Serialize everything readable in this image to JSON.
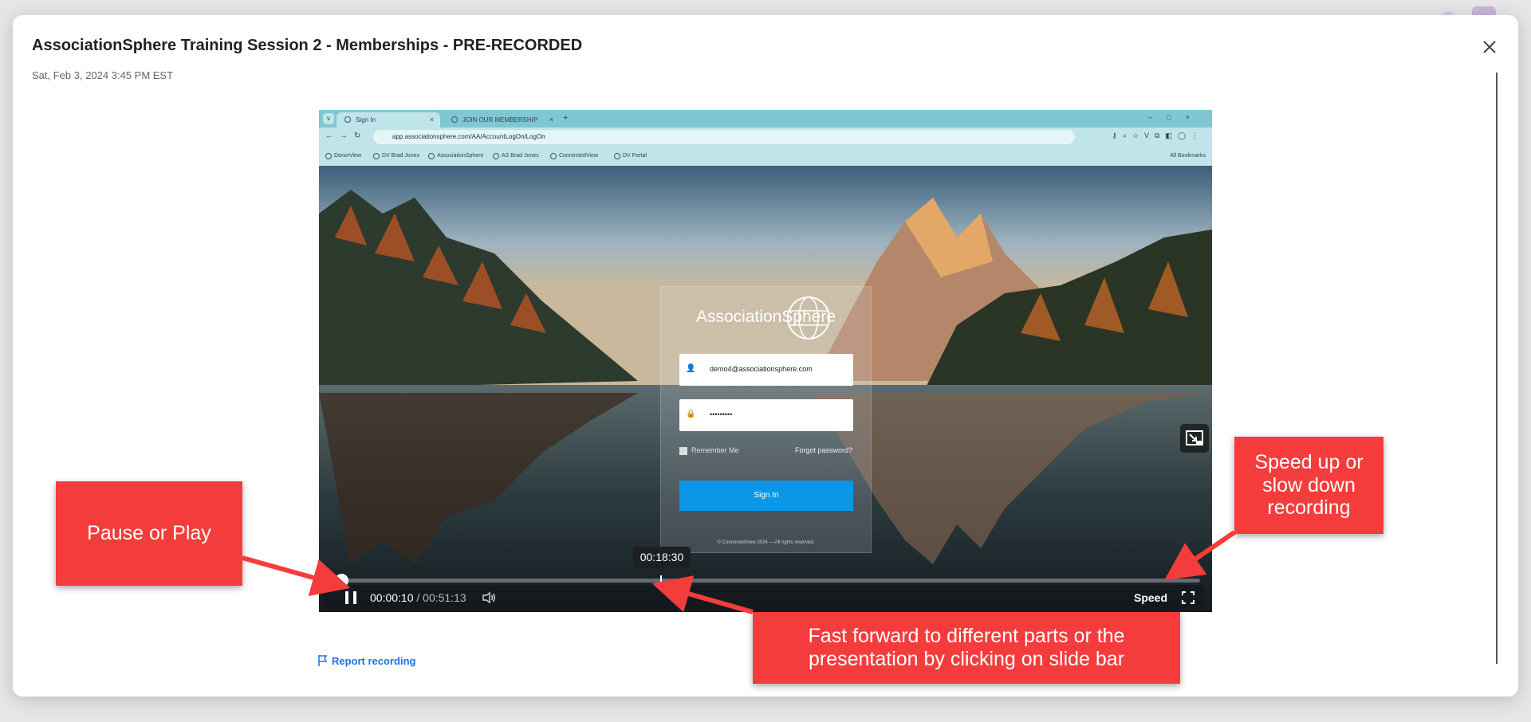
{
  "modal": {
    "title": "AssociationSphere Training Session 2 - Memberships - PRE-RECORDED",
    "date": "Sat, Feb 3, 2024 3:45 PM EST",
    "close_icon": "close-icon"
  },
  "browser": {
    "tabs": [
      {
        "label": "Sign In",
        "active": true
      },
      {
        "label": "JOIN OUR MEMBERSHIP",
        "active": false
      }
    ],
    "url": "app.associationsphere.com/AA/AccountLogOn/LogOn",
    "bookmarks": [
      "DonorView",
      "DV Brad Jones",
      "AssociationSphere",
      "AS Brad Jones",
      "ConnectedView",
      "DV Portal"
    ],
    "all_bookmarks": "All Bookmarks"
  },
  "login": {
    "brand": "AssociationSphere",
    "email": "demo4@associationsphere.com",
    "password_mask": "•••••••••",
    "remember": "Remember Me",
    "forgot": "Forgot password?",
    "signin": "Sign In",
    "copyright": "© ConnectedView 2024 — All rights reserved."
  },
  "player": {
    "hover_time": "00:18:30",
    "current_time": "00:00:10",
    "separator": " / ",
    "duration": "00:51:13",
    "speed_label": "Speed",
    "progress_fraction": 0.0033
  },
  "report_label": "Report recording",
  "annotations": {
    "pause": "Pause or Play",
    "speed": "Speed up or slow down recording",
    "seek": "Fast forward to different parts or the presentation by clicking on slide bar"
  },
  "colors": {
    "accent": "#1a73e8",
    "callout": "#f43c3c",
    "signin_button": "#0a98e6"
  }
}
